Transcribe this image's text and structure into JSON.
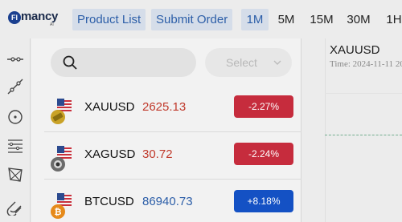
{
  "header": {
    "logo_text": "mancy",
    "logo_badge": "FI",
    "logo_sub": "AI",
    "nav": [
      "Product List",
      "Submit Order"
    ],
    "timeframes": [
      "1M",
      "5M",
      "15M",
      "30M",
      "1H"
    ],
    "active_timeframe": "1M"
  },
  "toolbar": {
    "tools": [
      "horizontal-line-icon",
      "trend-line-icon",
      "circle-icon",
      "fibonacci-icon",
      "polygon-icon",
      "magnet-icon"
    ]
  },
  "panel": {
    "search": {
      "placeholder": ""
    },
    "select": {
      "placeholder": "Select"
    },
    "rows": [
      {
        "symbol": "XAUUSD",
        "price": "2625.13",
        "change": "-2.27%",
        "price_color": "#c0392b",
        "badge_color": "#c62c3d",
        "coin": "gold"
      },
      {
        "symbol": "XAGUSD",
        "price": "30.72",
        "change": "-2.24%",
        "price_color": "#c0392b",
        "badge_color": "#c62c3d",
        "coin": "silver"
      },
      {
        "symbol": "BTCUSD",
        "price": "86940.73",
        "change": "+8.18%",
        "price_color": "#2c5ea8",
        "badge_color": "#1451c4",
        "coin": "bitcoin"
      }
    ]
  },
  "chart": {
    "symbol": "XAUUSD",
    "time": "Time: 2024-11-11 20"
  }
}
